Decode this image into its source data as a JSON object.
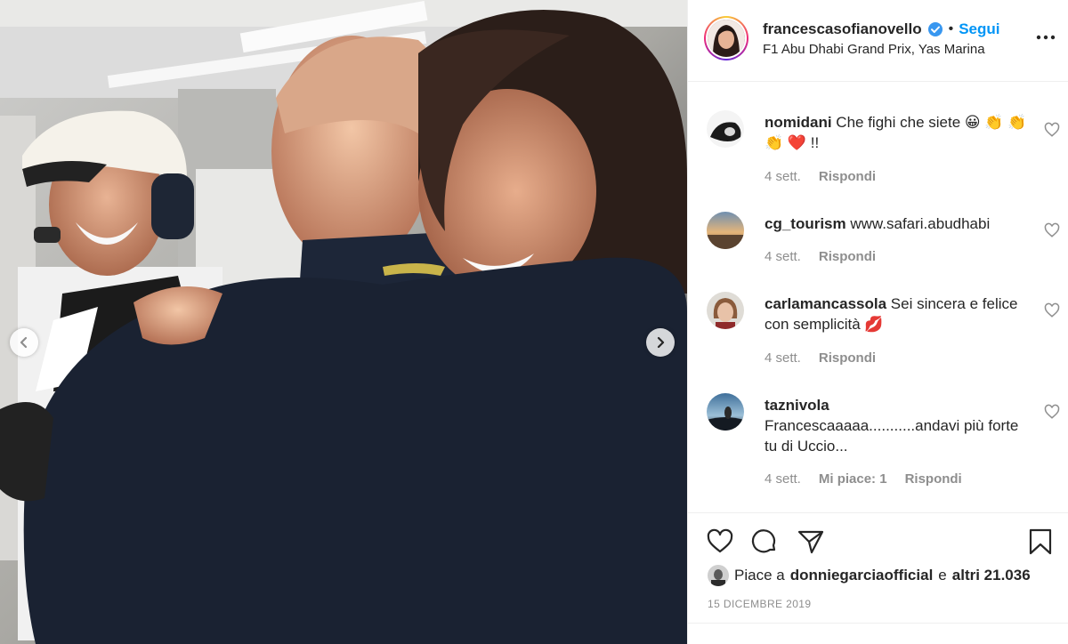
{
  "header": {
    "username": "francescasofianovello",
    "separator": "•",
    "follow_label": "Segui",
    "location": "F1 Abu Dhabi Grand Prix, Yas Marina",
    "verified_icon": "verified-badge-icon",
    "more_icon": "more-options-icon"
  },
  "carousel": {
    "prev_icon": "chevron-left-icon",
    "next_icon": "chevron-right-icon"
  },
  "comments": [
    {
      "username": "nomidani",
      "text": "Che fighi che siete 😀 👏 👏 👏 ❤️ !!",
      "time": "4 sett.",
      "likes": "",
      "reply_label": "Rispondi"
    },
    {
      "username": "cg_tourism",
      "text": "www.safari.abudhabi",
      "time": "4 sett.",
      "likes": "",
      "reply_label": "Rispondi"
    },
    {
      "username": "carlamancassola",
      "text": "Sei sincera e felice con semplicità 💋",
      "time": "4 sett.",
      "likes": "",
      "reply_label": "Rispondi"
    },
    {
      "username": "taznivola",
      "text": "Francescaaaaa...........andavi più forte tu di Uccio...",
      "time": "4 sett.",
      "likes": "Mi piace: 1",
      "reply_label": "Rispondi"
    }
  ],
  "actions": {
    "like_icon": "heart-icon",
    "comment_icon": "comment-icon",
    "share_icon": "paper-plane-icon",
    "save_icon": "bookmark-icon"
  },
  "likes": {
    "prefix": "Piace a",
    "user": "donniegarciaofficial",
    "joiner": "e",
    "others": "altri 21.036"
  },
  "date": "15 DICEMBRE 2019",
  "colors": {
    "accent": "#0095f6",
    "muted": "#8e8e8e",
    "text": "#262626",
    "heart_red": "#ed4956"
  }
}
